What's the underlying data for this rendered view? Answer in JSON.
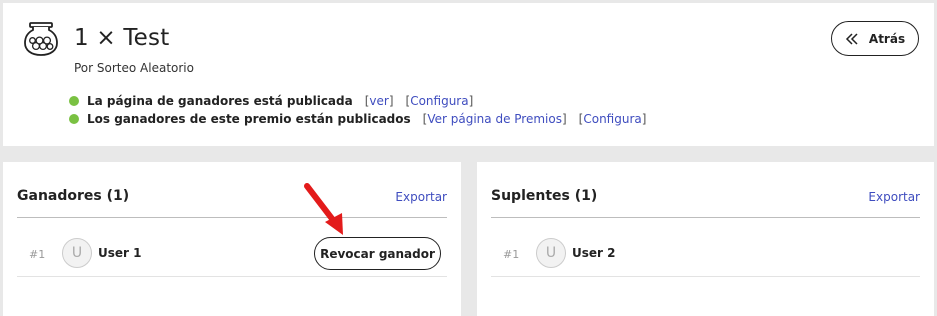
{
  "header": {
    "title": "1 × Test",
    "subtitle": "Por Sorteo Aleatorio",
    "back_label": "Atrás",
    "status": [
      {
        "text": "La página de ganadores está publicada",
        "links": [
          "ver",
          "Configura"
        ]
      },
      {
        "text": "Los ganadores de este premio están publicados",
        "links": [
          "Ver página de Premios",
          "Configura"
        ]
      }
    ],
    "status_color": "#7ac142"
  },
  "winners": {
    "title": "Ganadores (1)",
    "export_label": "Exportar",
    "rows": [
      {
        "rank": "#1",
        "avatar_letter": "U",
        "name": "User 1",
        "action_label": "Revocar ganador"
      }
    ]
  },
  "substitutes": {
    "title": "Suplentes (1)",
    "export_label": "Exportar",
    "rows": [
      {
        "rank": "#1",
        "avatar_letter": "U",
        "name": "User 2"
      }
    ]
  },
  "colors": {
    "link": "#3f4dbf",
    "annotation_arrow": "#e31b1b",
    "background": "#e8e8e8"
  },
  "icons": {
    "header": "lottery-jar-icon",
    "back": "double-chevron-left-icon",
    "annotation": "red-arrow-icon"
  }
}
